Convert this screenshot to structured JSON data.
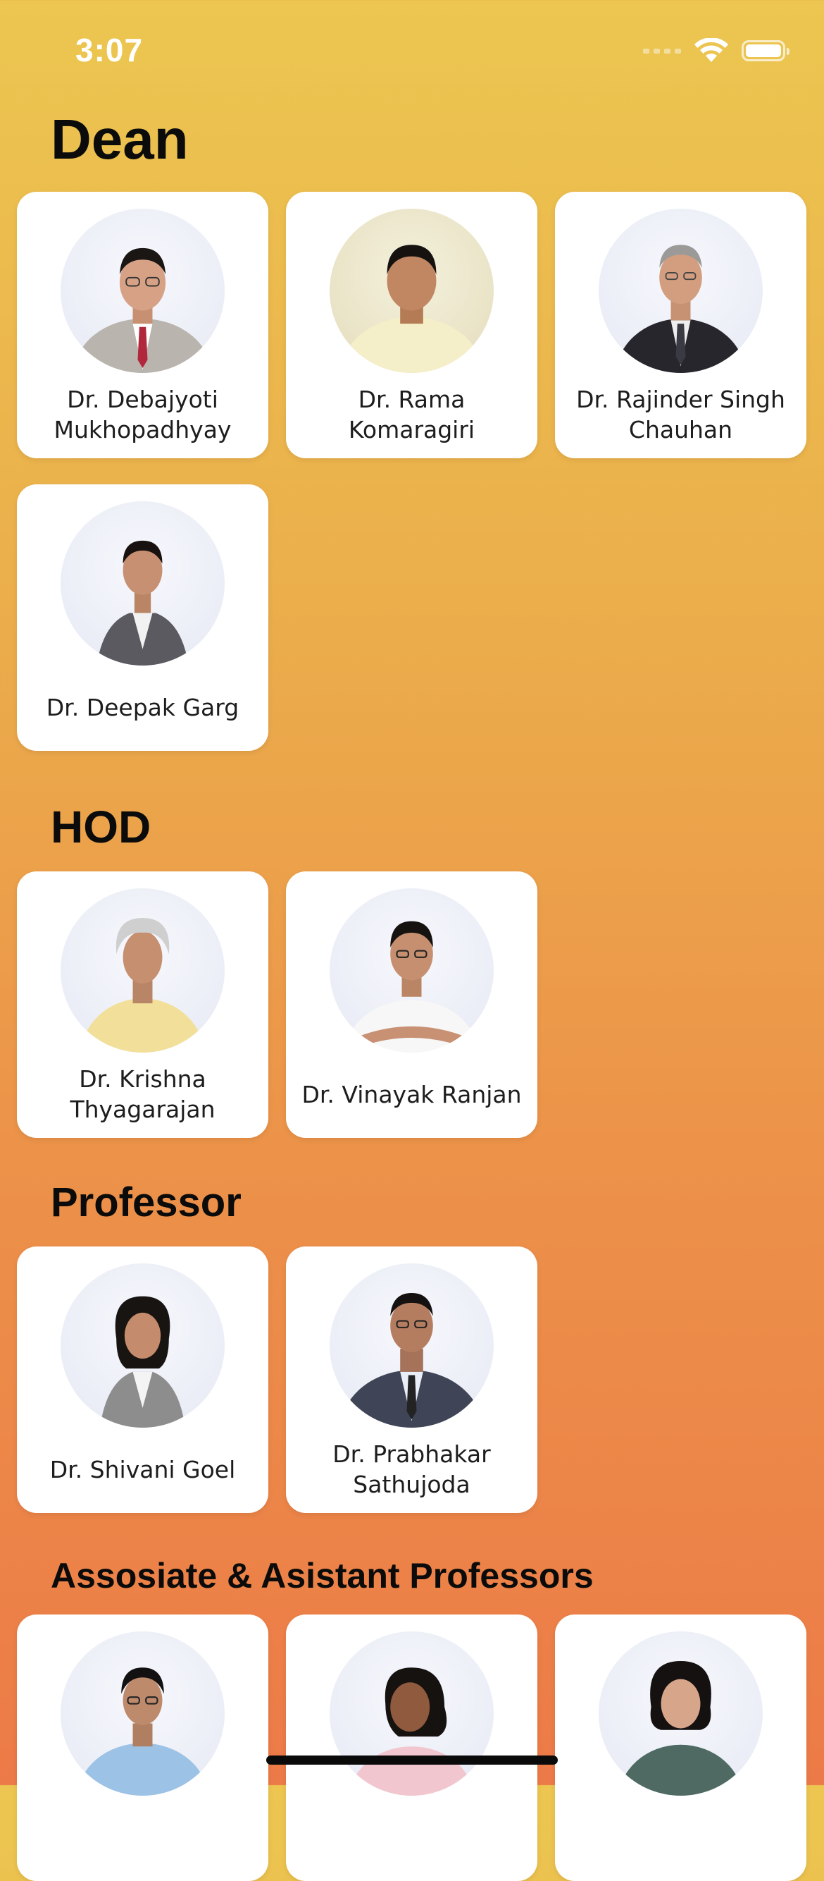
{
  "status_bar": {
    "time": "3:07",
    "icons": [
      "cellular-signal-icon",
      "wifi-icon",
      "battery-icon"
    ]
  },
  "sections": [
    {
      "title": "Dean",
      "people": [
        {
          "name": "Dr. Debajyoti\nMukhopadhyay",
          "photo": "portrait-grey-suit-red-tie"
        },
        {
          "name": "Dr. Rama\nKomaragiri",
          "photo": "portrait-cream-shirt"
        },
        {
          "name": "Dr. Rajinder Singh\nChauhan",
          "photo": "portrait-dark-suit"
        },
        {
          "name": "Dr. Deepak Garg",
          "photo": "portrait-grey-blazer"
        }
      ]
    },
    {
      "title": "HOD",
      "people": [
        {
          "name": "Dr. Krishna\nThyagarajan",
          "photo": "portrait-yellow-shirt"
        },
        {
          "name": "Dr. Vinayak Ranjan",
          "photo": "portrait-white-shirt-arms-crossed"
        }
      ]
    },
    {
      "title": "Professor",
      "people": [
        {
          "name": "Dr. Shivani Goel",
          "photo": "portrait-grey-blazer-woman"
        },
        {
          "name": "Dr. Prabhakar\nSathujoda",
          "photo": "portrait-navy-suit"
        }
      ]
    },
    {
      "title": "Assosiate & Asistant Professors",
      "people": [
        {
          "name": "",
          "photo": "portrait-blue-shirt"
        },
        {
          "name": "",
          "photo": "portrait-pink-top-woman"
        },
        {
          "name": "",
          "photo": "portrait-green-top-woman"
        }
      ]
    }
  ],
  "colors": {
    "gradient_top": "#ecc650",
    "gradient_bottom": "#ec7a48",
    "card": "#ffffff",
    "title_text": "#0b0b0b"
  }
}
